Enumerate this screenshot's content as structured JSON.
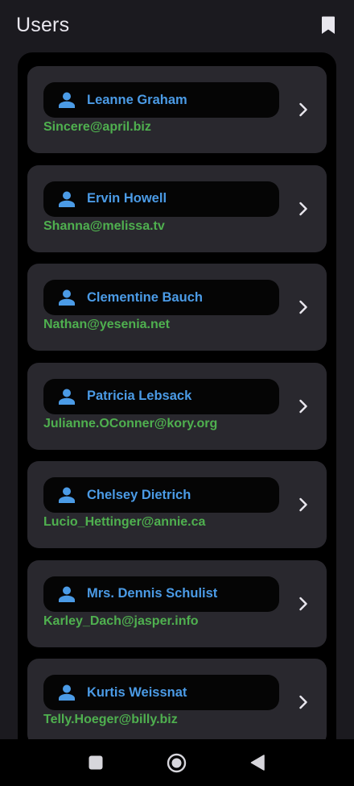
{
  "app_bar": {
    "title": "Users",
    "bookmark_icon": "bookmark-icon"
  },
  "users": [
    {
      "name": "Leanne Graham",
      "email": "Sincere@april.biz"
    },
    {
      "name": "Ervin Howell",
      "email": "Shanna@melissa.tv"
    },
    {
      "name": "Clementine Bauch",
      "email": "Nathan@yesenia.net"
    },
    {
      "name": "Patricia Lebsack",
      "email": "Julianne.OConner@kory.org"
    },
    {
      "name": "Chelsey Dietrich",
      "email": "Lucio_Hettinger@annie.ca"
    },
    {
      "name": "Mrs. Dennis Schulist",
      "email": "Karley_Dach@jasper.info"
    },
    {
      "name": "Kurtis Weissnat",
      "email": "Telly.Hoeger@billy.biz"
    }
  ],
  "icons": {
    "person": "person-icon",
    "chevron": "chevron-right-icon",
    "nav_recents": "square-icon",
    "nav_home": "circle-icon",
    "nav_back": "triangle-back-icon"
  },
  "colors": {
    "background": "#1b1a1f",
    "panel": "#000000",
    "card": "#29282e",
    "name_pill": "#050505",
    "name": "#4b9be6",
    "email": "#4fb04f",
    "title": "#e9e7ee"
  }
}
